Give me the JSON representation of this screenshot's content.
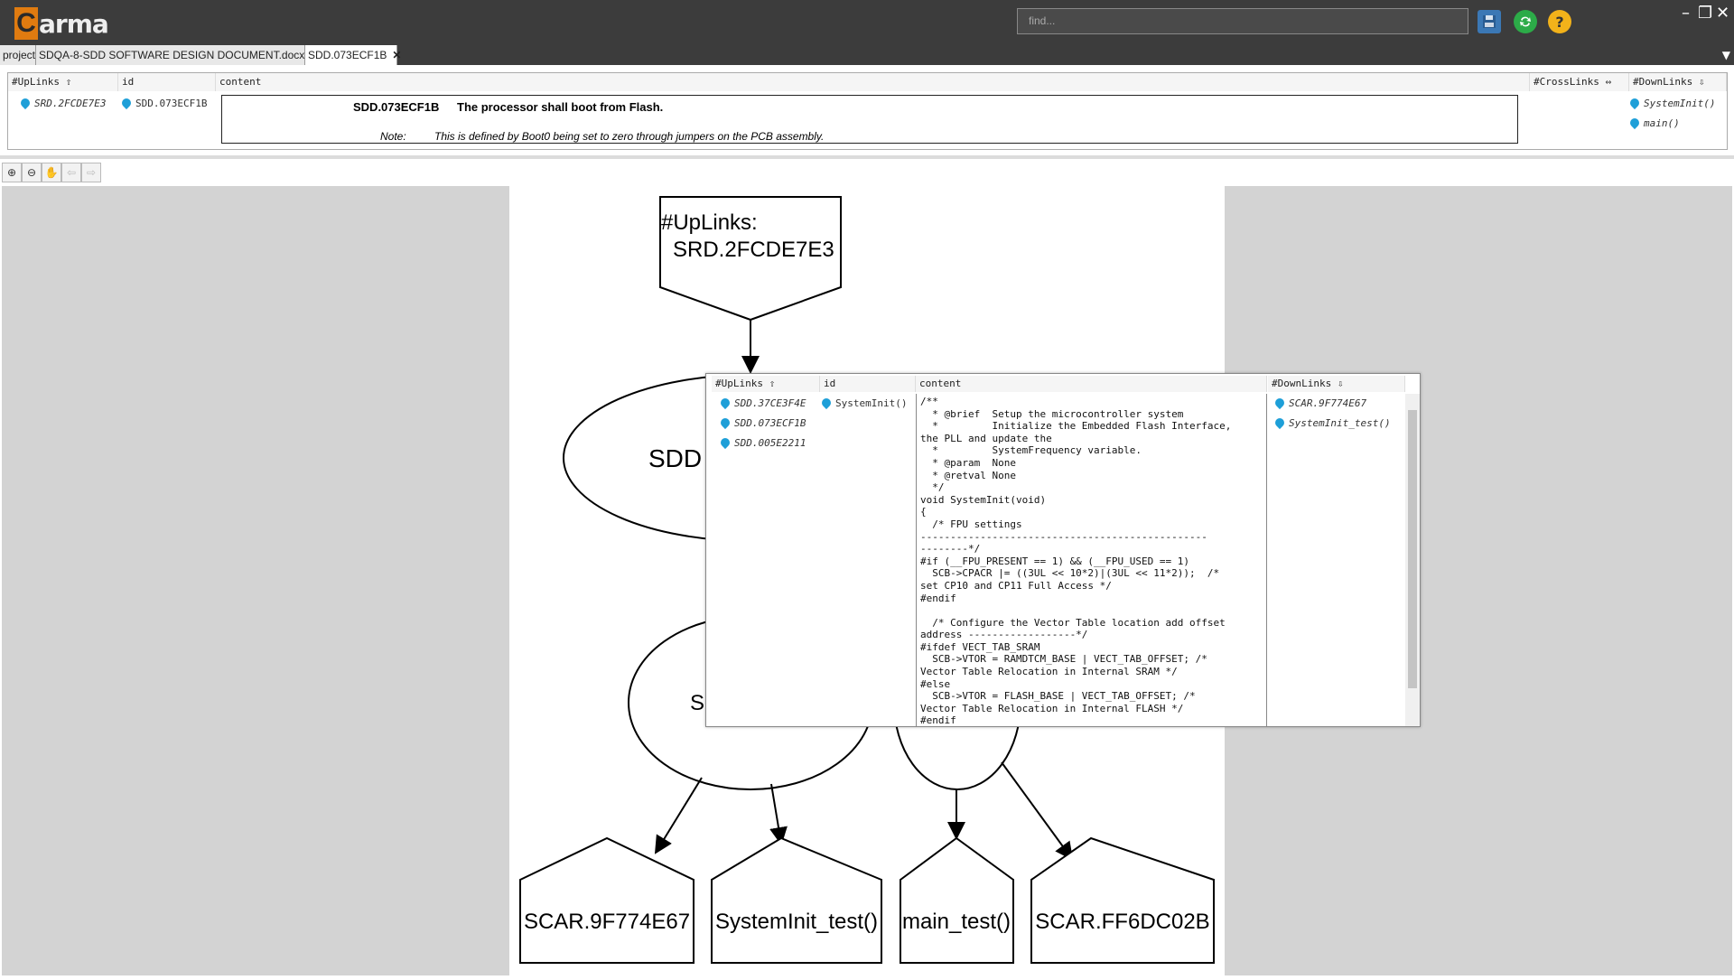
{
  "app": {
    "logo_letter": "C",
    "logo_text": "arma",
    "find_placeholder": "find...",
    "save_icon": "save-icon",
    "sync_icon": "sync-icon",
    "help_icon": "help-icon",
    "help_label": "?",
    "min_label": "–",
    "restore_label": "❐",
    "close_label": "✕"
  },
  "tabs": [
    {
      "label": "project"
    },
    {
      "label": "SDQA-8-SDD SOFTWARE DESIGN DOCUMENT.docx"
    },
    {
      "label": "SDD.073ECF1B",
      "close": "✕"
    }
  ],
  "grid": {
    "headers": {
      "uplinks": "#UpLinks ⇧",
      "id": "id",
      "content": "content",
      "crosslinks": "#CrossLinks ⇔",
      "downlinks": "#DownLinks ⇩"
    },
    "uplink": "SRD.2FCDE7E3",
    "id": "SDD.073ECF1B",
    "req_id": "SDD.073ECF1B",
    "req_text": "The processor shall boot from Flash.",
    "note_label": "Note:",
    "note_text": "This is defined by Boot0 being set to zero through jumpers on the PCB assembly.",
    "downlinks": [
      "SystemInit()",
      "main()"
    ]
  },
  "toolbar": {
    "zoom_in": "⊕",
    "zoom_out": "⊖",
    "pan": "✋",
    "back": "⇦",
    "forward": "⇨"
  },
  "diagram": {
    "top_label_1": "#UpLinks:",
    "top_label_2": "SRD.2FCDE7E3",
    "ellipse1_label": "SDD",
    "ellipse2_label": "S",
    "bottom_nodes": [
      "SCAR.9F774E67",
      "SystemInit_test()",
      "main_test()",
      "SCAR.FF6DC02B"
    ]
  },
  "popup": {
    "headers": {
      "uplinks": "#UpLinks ⇧",
      "id": "id",
      "content": "content",
      "downlinks": "#DownLinks ⇩"
    },
    "uplinks": [
      "SDD.37CE3F4E",
      "SDD.073ECF1B",
      "SDD.005E2211"
    ],
    "id": "SystemInit()",
    "downlinks": [
      "SCAR.9F774E67",
      "SystemInit_test()"
    ],
    "code": "/**\n  * @brief  Setup the microcontroller system\n  *         Initialize the Embedded Flash Interface,\nthe PLL and update the\n  *         SystemFrequency variable.\n  * @param  None\n  * @retval None\n  */\nvoid SystemInit(void)\n{\n  /* FPU settings\n------------------------------------------------\n--------*/\n#if (__FPU_PRESENT == 1) && (__FPU_USED == 1)\n  SCB->CPACR |= ((3UL << 10*2)|(3UL << 11*2));  /*\nset CP10 and CP11 Full Access */\n#endif\n\n  /* Configure the Vector Table location add offset\naddress ------------------*/\n#ifdef VECT_TAB_SRAM\n  SCB->VTOR = RAMDTCM_BASE | VECT_TAB_OFFSET; /*\nVector Table Relocation in Internal SRAM */\n#else\n  SCB->VTOR = FLASH_BASE | VECT_TAB_OFFSET; /*\nVector Table Relocation in Internal FLASH */\n#endif"
  }
}
